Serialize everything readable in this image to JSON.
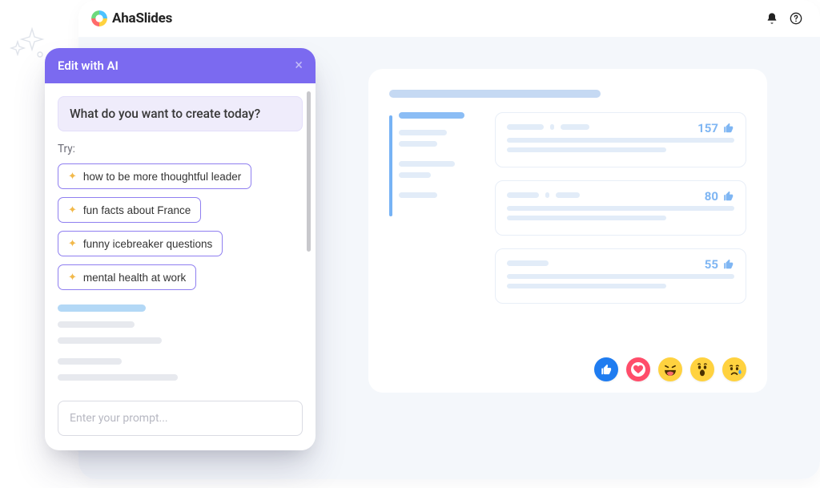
{
  "brand": {
    "name": "AhaSlides"
  },
  "ai_panel": {
    "title": "Edit with AI",
    "hero": "What do you want to create today?",
    "try_label": "Try:",
    "chips": [
      "how to be more thoughtful leader",
      "fun facts about France",
      "funny icebreaker questions",
      "mental health at work"
    ],
    "prompt_placeholder": "Enter your prompt..."
  },
  "preview": {
    "cards": [
      {
        "count": 157
      },
      {
        "count": 80
      },
      {
        "count": 55
      }
    ]
  }
}
